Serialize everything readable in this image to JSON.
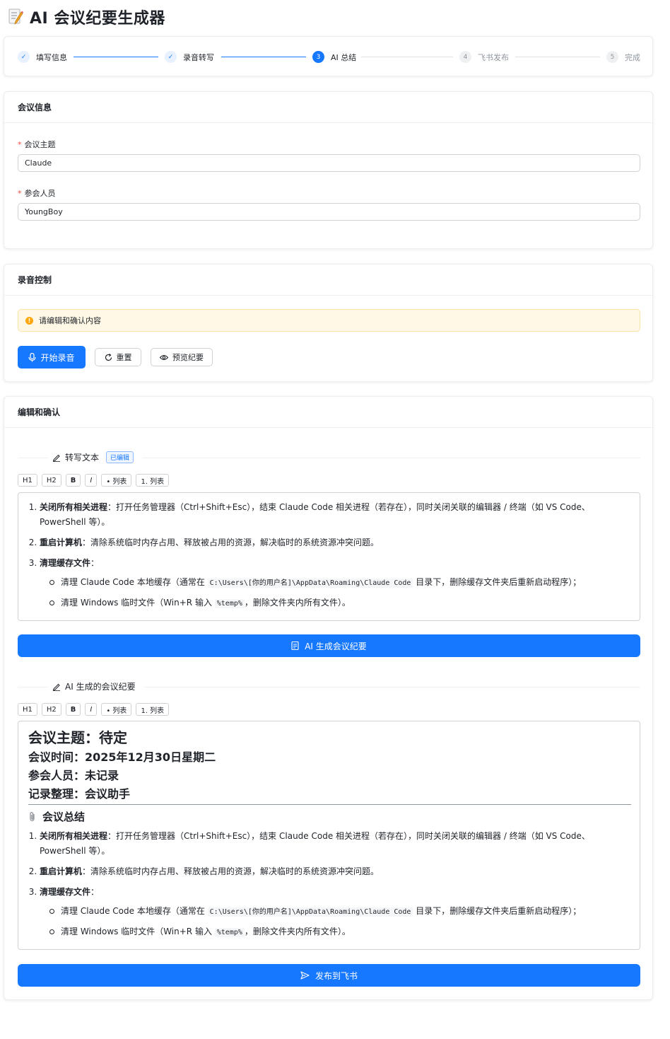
{
  "app": {
    "title": "AI 会议纪要生成器",
    "icon": "memo-icon"
  },
  "steps": [
    {
      "num": "✓",
      "label": "填写信息",
      "state": "done"
    },
    {
      "num": "✓",
      "label": "录音转写",
      "state": "done"
    },
    {
      "num": "3",
      "label": "AI 总结",
      "state": "active"
    },
    {
      "num": "4",
      "label": "飞书发布",
      "state": "todo"
    },
    {
      "num": "5",
      "label": "完成",
      "state": "todo"
    }
  ],
  "meeting_info": {
    "title": "会议信息",
    "topic_label": "会议主题",
    "topic_value": "Claude",
    "attendees_label": "参会人员",
    "attendees_value": "YoungBoy"
  },
  "recording": {
    "title": "录音控制",
    "alert": "请编辑和确认内容",
    "start_label": "开始录音",
    "reset_label": "重置",
    "preview_label": "预览纪要"
  },
  "edit": {
    "title": "编辑和确认",
    "transcript_title": "转写文本",
    "edited_badge": "已编辑",
    "toolbar": [
      "H1",
      "H2",
      "B",
      "I",
      "• 列表",
      "1. 列表"
    ],
    "generate_label": "AI 生成会议纪要",
    "summary_title": "AI 生成的会议纪要",
    "publish_label": "发布到飞书"
  },
  "content": {
    "item1_bold": "关闭所有相关进程",
    "item1_text": "：打开任务管理器（Ctrl+Shift+Esc），结束 Claude Code 相关进程（若存在），同时关闭关联的编辑器 / 终端（如 VS Code、PowerShell 等）。",
    "item2_bold": "重启计算机",
    "item2_text": "：清除系统临时内存占用、释放被占用的资源，解决临时的系统资源冲突问题。",
    "item3_bold": "清理缓存文件",
    "item3_text": "：",
    "sub1_pre": "清理 Claude Code 本地缓存（通常在 ",
    "sub1_code": "C:\\Users\\[你的用户名]\\AppData\\Roaming\\Claude Code",
    "sub1_post": " 目录下，删除缓存文件夹后重新启动程序）；",
    "sub2_pre": "清理 Windows 临时文件（Win+R 输入 ",
    "sub2_code": "%temp%",
    "sub2_post": "，删除文件夹内所有文件）。"
  },
  "summary_doc": {
    "topic": "会议主题：待定",
    "time": "会议时间：2025年12月30日星期二",
    "attendees": "参会人员：未记录",
    "recorder": "记录整理：会议助手",
    "section": "会议总结",
    "section_icon": "paperclip-icon"
  },
  "colors": {
    "primary": "#1677ff",
    "warning": "#ffa70f",
    "required": "#f54a45"
  }
}
